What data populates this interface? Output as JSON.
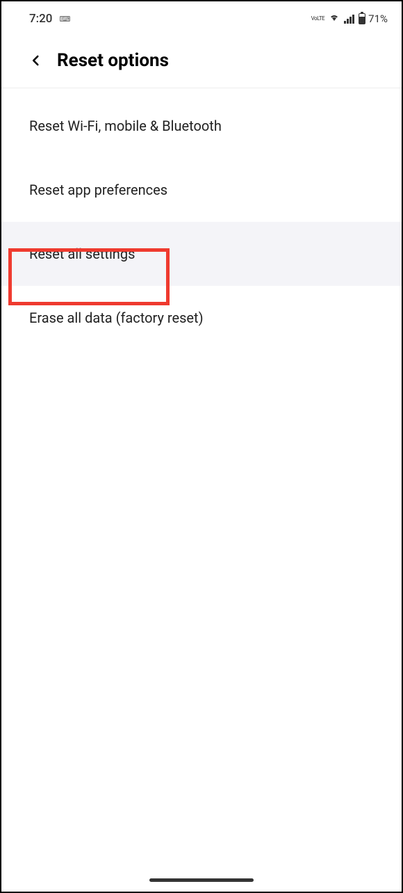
{
  "status_bar": {
    "time": "7:20",
    "lte_label": "VoLTE",
    "battery_percent": "71%"
  },
  "header": {
    "title": "Reset options"
  },
  "menu": {
    "items": [
      {
        "label": "Reset Wi-Fi, mobile & Bluetooth"
      },
      {
        "label": "Reset app preferences"
      },
      {
        "label": "Reset all settings"
      },
      {
        "label": "Erase all data (factory reset)"
      }
    ]
  }
}
